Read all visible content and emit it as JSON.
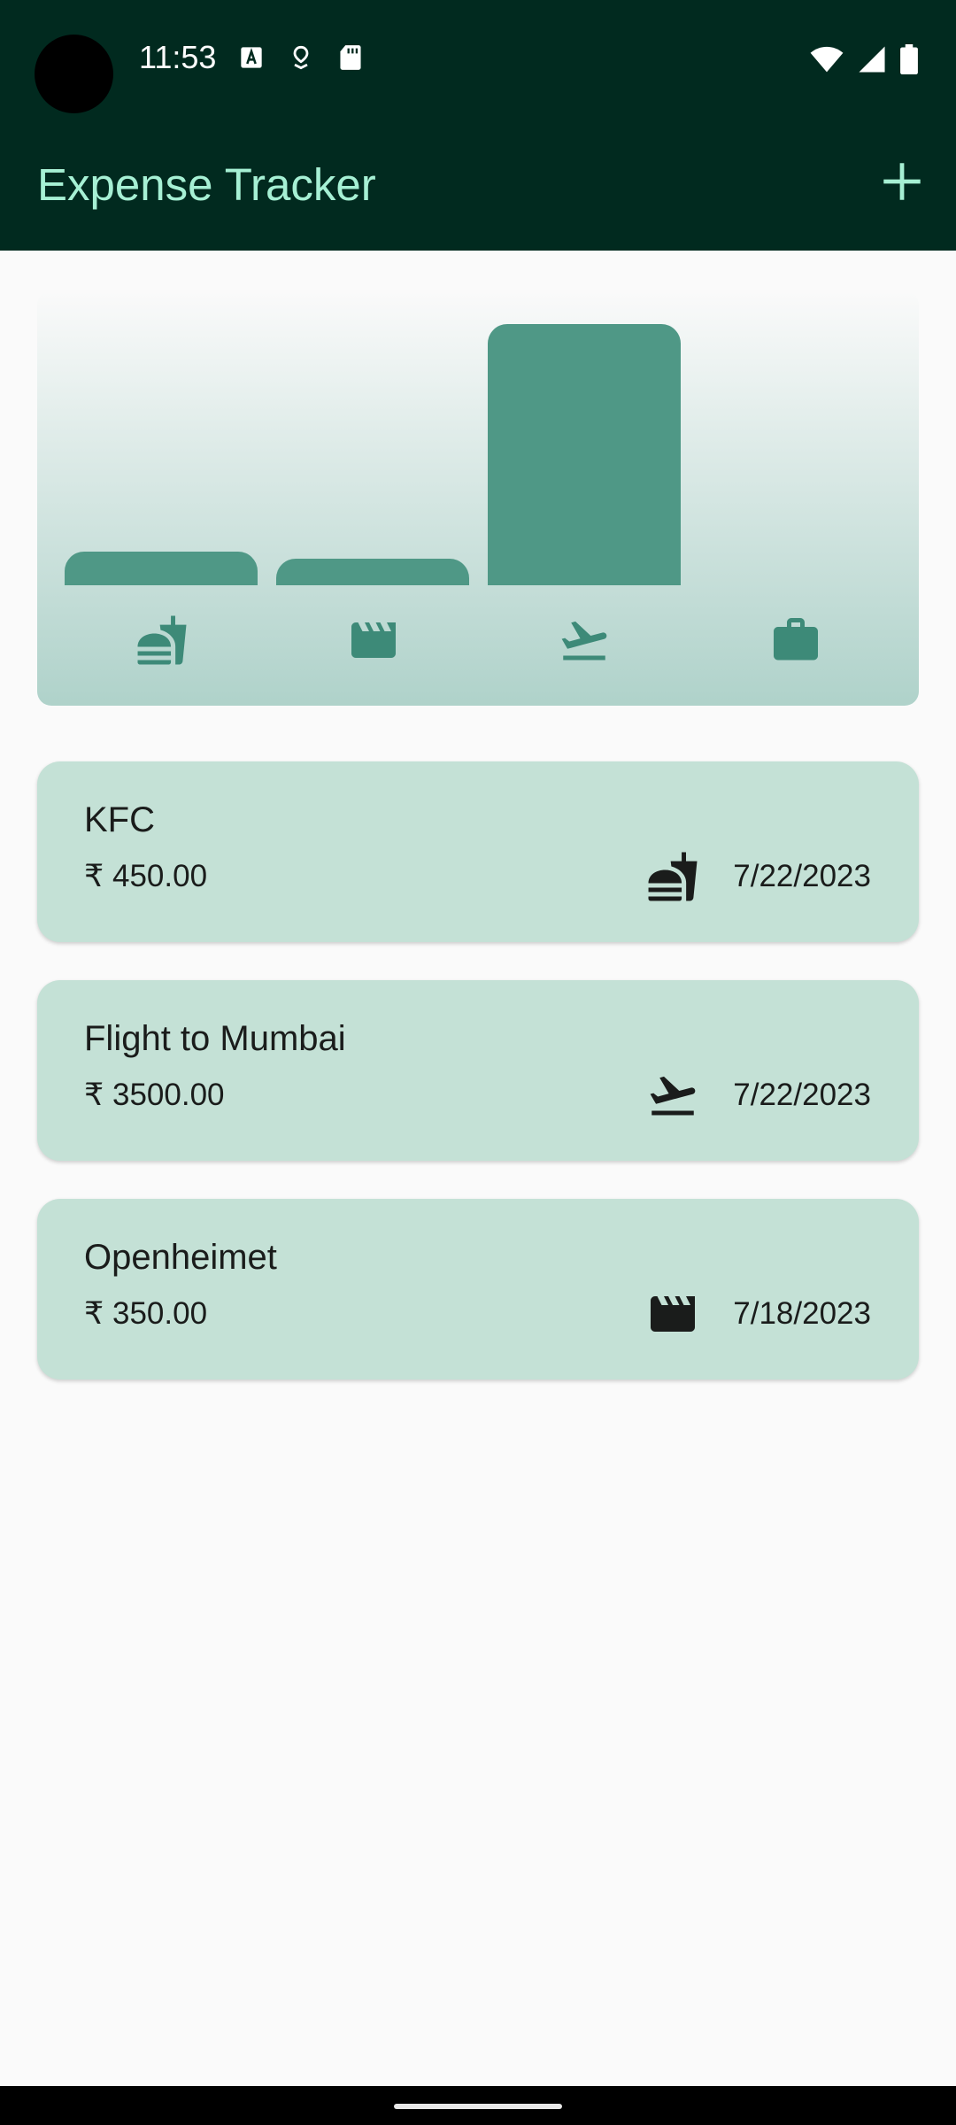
{
  "status_bar": {
    "time": "11:53",
    "left_icons": [
      "font-a-icon",
      "location-pin-icon",
      "sd-card-icon"
    ],
    "right_icons": [
      "wifi-icon",
      "cell-signal-icon",
      "battery-icon"
    ]
  },
  "app_bar": {
    "title": "Expense Tracker",
    "add_icon": "plus-icon"
  },
  "colors": {
    "app_bar_bg": "#012a1f",
    "title_color": "#a6f0d4",
    "bar_color": "#4f9886",
    "card_bg": "#c4e1d6",
    "icon_accent": "#3d8a78"
  },
  "chart_data": {
    "type": "bar",
    "categories": [
      "food",
      "leisure",
      "travel",
      "work"
    ],
    "category_icons": [
      "fastfood-icon",
      "movie-icon",
      "flight-icon",
      "work-icon"
    ],
    "values": [
      450,
      350,
      3500,
      0
    ],
    "ylim": [
      0,
      3500
    ]
  },
  "expenses": [
    {
      "title": "KFC",
      "amount": "₹ 450.00",
      "date": "7/22/2023",
      "category_icon": "fastfood-icon"
    },
    {
      "title": "Flight to Mumbai",
      "amount": "₹ 3500.00",
      "date": "7/22/2023",
      "category_icon": "flight-icon"
    },
    {
      "title": "Openheimet",
      "amount": "₹ 350.00",
      "date": "7/18/2023",
      "category_icon": "movie-icon"
    }
  ]
}
